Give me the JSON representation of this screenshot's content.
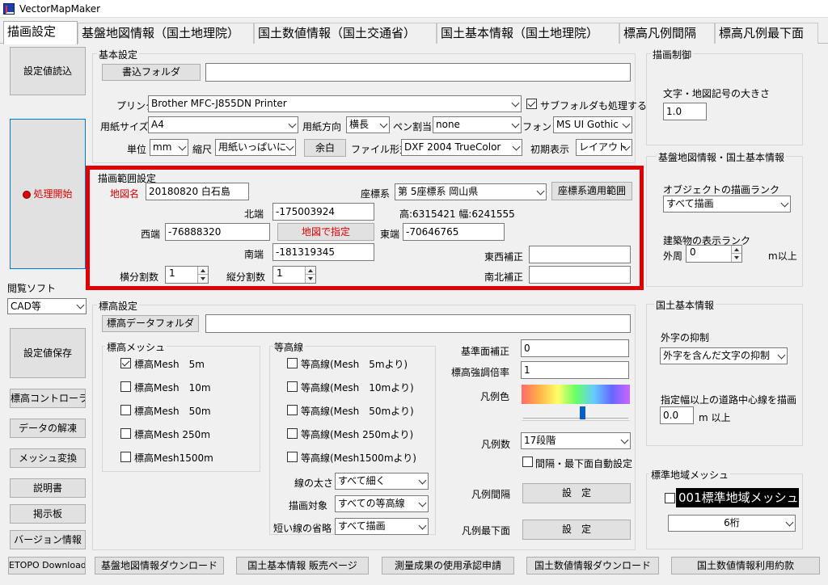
{
  "app": {
    "title": "VectorMapMaker"
  },
  "tabs": [
    "描画設定",
    "基盤地図情報（国土地理院）",
    "国土数値情報（国土交通省）",
    "国土基本情報（国土地理院）",
    "標高凡例間隔",
    "標高凡例最下面"
  ],
  "left": {
    "load_settings": "設定値読込",
    "start": "処理開始",
    "viewer_label": "閲覧ソフト",
    "viewer_value": "CAD等",
    "save_settings": "設定値保存",
    "buttons": [
      "標高コントローラ",
      "データの解凍",
      "メッシュ変換",
      "説明書",
      "掲示板",
      "バージョン情報"
    ]
  },
  "basic": {
    "group": "基本設定",
    "folder_btn": "書込フォルダ",
    "folder_value": "",
    "printer_label": "プリンタ",
    "printer_value": "Brother MFC-J855DN Printer",
    "subfolder_label": "サブフォルダも処理する",
    "subfolder_checked": true,
    "paper_size_label": "用紙サイズ",
    "paper_size_value": "A4",
    "orient_label": "用紙方向",
    "orient_value": "横長",
    "pen_label": "ペン割当",
    "pen_value": "none",
    "font_label": "フォント",
    "font_value": "MS UI Gothic",
    "unit_label": "単位",
    "unit_value": "mm",
    "scale_label": "縮尺",
    "scale_value": "用紙いっぱいに",
    "margin_btn": "余白",
    "filefmt_label": "ファイル形式",
    "filefmt_value": "DXF 2004 TrueColor",
    "initview_label": "初期表示",
    "initview_value": "レイアウト"
  },
  "range": {
    "group": "描画範囲設定",
    "mapname_label": "地図名",
    "mapname_value": "20180820 白石島",
    "coord_label": "座標系",
    "coord_value": "第 5座標系 岡山県",
    "coord_btn": "座標系適用範囲",
    "north_label": "北端",
    "north_value": "-175003924",
    "size_text": "高:6315421 幅:6241555",
    "west_label": "西端",
    "west_value": "-76888320",
    "map_btn": "地図で指定",
    "east_label": "東端",
    "east_value": "-70646765",
    "south_label": "南端",
    "south_value": "-181319345",
    "ew_label": "東西補正",
    "ew_value": "",
    "ns_label": "南北補正",
    "ns_value": "",
    "hdiv_label": "横分割数",
    "hdiv_value": "1",
    "vdiv_label": "縦分割数",
    "vdiv_value": "1"
  },
  "elev": {
    "group": "標高設定",
    "folder_btn": "標高データフォルダ",
    "folder_value": "",
    "mesh_group": "標高メッシュ",
    "mesh": [
      {
        "label": "標高Mesh　5m",
        "checked": true
      },
      {
        "label": "標高Mesh　10m",
        "checked": false
      },
      {
        "label": "標高Mesh　50m",
        "checked": false
      },
      {
        "label": "標高Mesh 250m",
        "checked": false
      },
      {
        "label": "標高Mesh1500m",
        "checked": false
      }
    ],
    "contour_group": "等高線",
    "contour": [
      {
        "label": "等高線(Mesh　5mより)",
        "checked": false
      },
      {
        "label": "等高線(Mesh　10mより)",
        "checked": false
      },
      {
        "label": "等高線(Mesh　50mより)",
        "checked": false
      },
      {
        "label": "等高線(Mesh 250mより)",
        "checked": false
      },
      {
        "label": "等高線(Mesh1500mより)",
        "checked": false
      }
    ],
    "linewidth_label": "線の太さ",
    "linewidth_value": "すべて細く",
    "target_label": "描画対象",
    "target_value": "すべての等高線",
    "omit_label": "短い線の省略",
    "omit_value": "すべて描画",
    "base_label": "基準面補正",
    "base_value": "0",
    "emph_label": "標高強調倍率",
    "emph_value": "1",
    "color_label": "凡例色",
    "slider_position": 0.57,
    "count_label": "凡例数",
    "count_value": "17段階",
    "auto_label": "間隔・最下面自動設定",
    "auto_checked": false,
    "interval_label": "凡例間隔",
    "interval_btn": "設　定",
    "bottom_label": "凡例最下面",
    "bottom_btn": "設　定"
  },
  "right": {
    "draw_group": "描画制御",
    "size_label": "文字・地図記号の大きさ",
    "size_value": "1.0",
    "kiban_group": "基盤地図情報・国土基本情報",
    "rank_label": "オブジェクトの描画ランク",
    "rank_value": "すべて描画",
    "bldg_label": "建築物の表示ランク",
    "outer_label": "外周",
    "outer_value": "0",
    "outer_unit": "m以上",
    "kokudo_group": "国土基本情報",
    "gaiji_label": "外字の抑制",
    "gaiji_value": "外字を含んだ文字の抑制",
    "road_label": "指定幅以上の道路中心線を描画",
    "road_value": "0.0",
    "road_unit": "m 以上",
    "mesh_group": "標準地域メッシュ",
    "mesh_label": "001標準地域メッシュ",
    "mesh_checked": false,
    "digits_value": "6桁"
  },
  "bottom": [
    "ETOPO Download",
    "基盤地図情報ダウンロード",
    "国土基本情報 販売ページ",
    "測量成果の使用承認申請",
    "国土数値情報ダウンロード",
    "国土数値情報利用約款"
  ],
  "colors": {
    "highlight": "#e00000",
    "active_tab": "#ffffff",
    "gradient": [
      "#ff6b6b",
      "#ffb347",
      "#ffff66",
      "#66ff66",
      "#66ccff",
      "#6666ff",
      "#cc66ff"
    ]
  }
}
